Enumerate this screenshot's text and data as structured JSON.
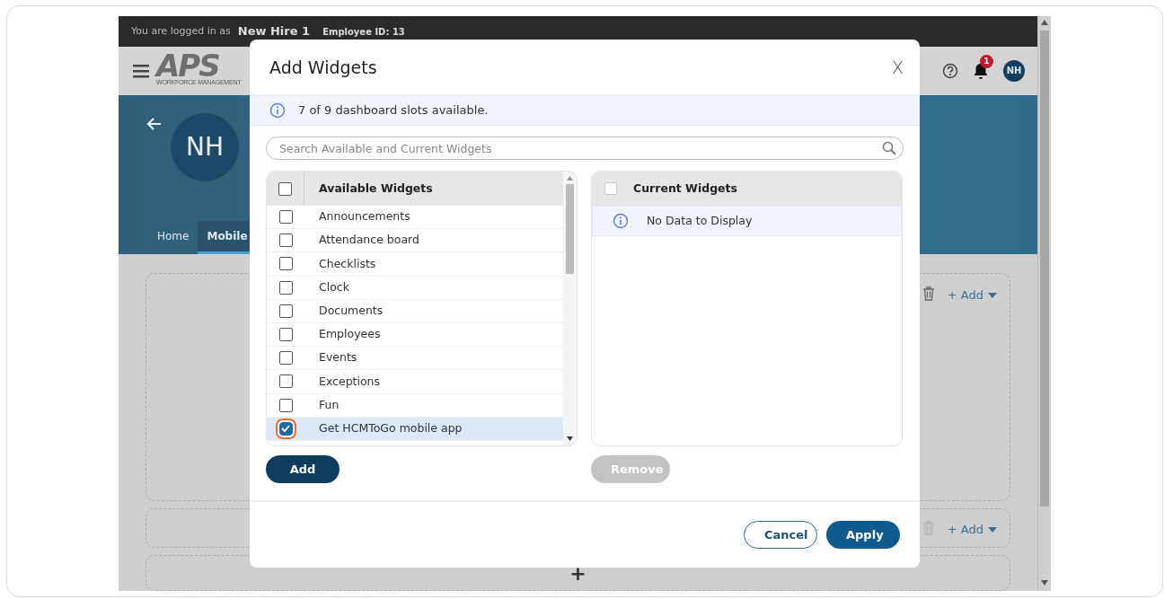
{
  "top_bar": {
    "logged_in_label": "You are logged in as",
    "user_name": "New Hire 1",
    "employee_id": "Employee ID: 13"
  },
  "header": {
    "logo": "APS",
    "logo_subtitle": "WORKFORCE MANAGEMENT",
    "notification_count": "1",
    "avatar": "NH"
  },
  "profile": {
    "avatar": "NH",
    "tabs": [
      {
        "label": "Home",
        "selected": false
      },
      {
        "label": "Mobile",
        "selected": true
      }
    ]
  },
  "dashboard": {
    "rows": [
      {
        "add_label": "+ Add",
        "trash_disabled": false
      },
      {
        "add_label": "+ Add",
        "trash_disabled": true
      }
    ],
    "add_row_label": "+"
  },
  "modal": {
    "title": "Add Widgets",
    "close": "X",
    "info": "7 of 9 dashboard slots available.",
    "search": {
      "placeholder": "Search Available and Current Widgets"
    },
    "available": {
      "heading": "Available Widgets",
      "select_all_checked": false,
      "items": [
        {
          "label": "Announcements",
          "checked": false,
          "highlighted": false
        },
        {
          "label": "Attendance board",
          "checked": false,
          "highlighted": false
        },
        {
          "label": "Checklists",
          "checked": false,
          "highlighted": false
        },
        {
          "label": "Clock",
          "checked": false,
          "highlighted": false
        },
        {
          "label": "Documents",
          "checked": false,
          "highlighted": false
        },
        {
          "label": "Employees",
          "checked": false,
          "highlighted": false
        },
        {
          "label": "Events",
          "checked": false,
          "highlighted": false
        },
        {
          "label": "Exceptions",
          "checked": false,
          "highlighted": false
        },
        {
          "label": "Fun",
          "checked": false,
          "highlighted": false
        },
        {
          "label": "Get HCMToGo mobile app",
          "checked": true,
          "highlighted": true
        }
      ]
    },
    "current": {
      "heading": "Current Widgets",
      "select_all_checked": false,
      "empty_text": "No Data to Display"
    },
    "add_button": {
      "label": "Add",
      "disabled": false
    },
    "remove_button": {
      "label": "Remove",
      "disabled": true
    },
    "cancel_button": "Cancel",
    "apply_button": "Apply"
  }
}
